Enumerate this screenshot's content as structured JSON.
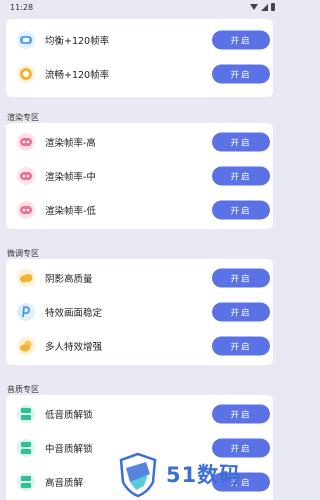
{
  "status_bar": {
    "time": "11:28"
  },
  "sections": [
    {
      "title": "",
      "rows": [
        {
          "label": "均衡+120帧率",
          "button": "开启",
          "icon": "balance-icon",
          "color": "#5ea8e8"
        },
        {
          "label": "流畅+120帧率",
          "button": "开启",
          "icon": "smooth-icon",
          "color": "#f2b233"
        }
      ]
    },
    {
      "title": "渲染专区",
      "rows": [
        {
          "label": "渲染帧率-高",
          "button": "开启",
          "icon": "render-icon",
          "color": "#f07090"
        },
        {
          "label": "渲染帧率-中",
          "button": "开启",
          "icon": "render-icon",
          "color": "#f07090"
        },
        {
          "label": "渲染帧率-低",
          "button": "开启",
          "icon": "render-icon",
          "color": "#f07090"
        }
      ]
    },
    {
      "title": "微调专区",
      "rows": [
        {
          "label": "阴影高质量",
          "button": "开启",
          "icon": "cloud-icon",
          "color": "#f2b233"
        },
        {
          "label": "特效画面稳定",
          "button": "开启",
          "icon": "feather-icon",
          "color": "#4a9ae8"
        },
        {
          "label": "多人特效增强",
          "button": "开启",
          "icon": "cloud-sun-icon",
          "color": "#f2b233"
        }
      ]
    },
    {
      "title": "音质专区",
      "rows": [
        {
          "label": "低音质解锁",
          "button": "开启",
          "icon": "audio-icon",
          "color": "#2fbf9a"
        },
        {
          "label": "中音质解锁",
          "button": "开启",
          "icon": "audio-icon",
          "color": "#2fbf9a"
        },
        {
          "label": "高音质解",
          "button": "开启",
          "icon": "audio-icon",
          "color": "#2fbf9a"
        }
      ]
    }
  ],
  "watermark": {
    "text": "51数码"
  },
  "colors": {
    "background": "#e8e9f2",
    "button": "#5b72e6"
  }
}
